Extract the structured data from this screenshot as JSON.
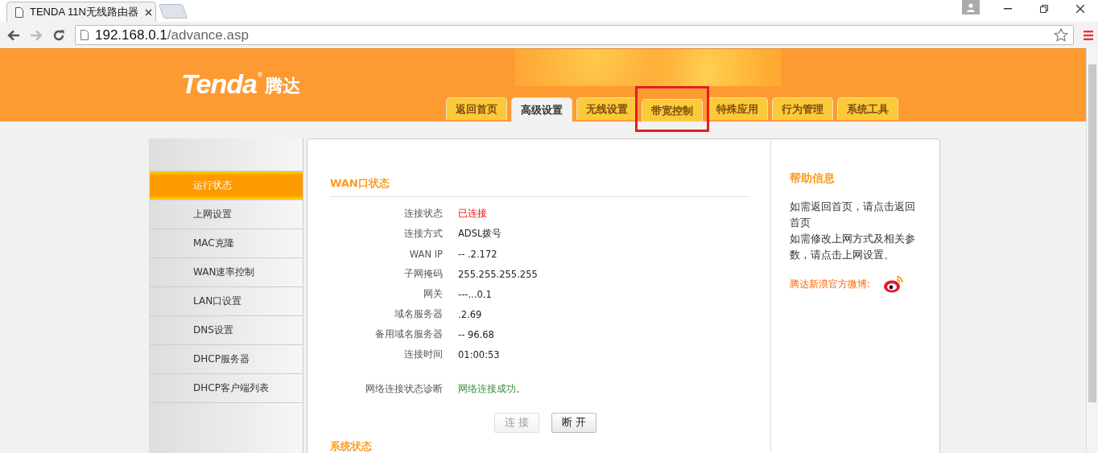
{
  "browser": {
    "tab_title": "TENDA 11N无线路由器",
    "address_host": "192.168.0.1",
    "address_path": "/advance.asp"
  },
  "header": {
    "logo": "Tenda",
    "logo_mark": "®",
    "logo_cn": "腾达",
    "tabs": [
      {
        "label": "返回首页",
        "selected": false,
        "highlighted": false
      },
      {
        "label": "高级设置",
        "selected": true,
        "highlighted": false
      },
      {
        "label": "无线设置",
        "selected": false,
        "highlighted": false
      },
      {
        "label": "带宽控制",
        "selected": false,
        "highlighted": true
      },
      {
        "label": "特殊应用",
        "selected": false,
        "highlighted": false
      },
      {
        "label": "行为管理",
        "selected": false,
        "highlighted": false
      },
      {
        "label": "系统工具",
        "selected": false,
        "highlighted": false
      }
    ]
  },
  "sidebar": {
    "items": [
      {
        "label": "运行状态",
        "selected": true
      },
      {
        "label": "上网设置",
        "selected": false
      },
      {
        "label": "MAC克隆",
        "selected": false
      },
      {
        "label": "WAN速率控制",
        "selected": false
      },
      {
        "label": "LAN口设置",
        "selected": false
      },
      {
        "label": "DNS设置",
        "selected": false
      },
      {
        "label": "DHCP服务器",
        "selected": false
      },
      {
        "label": "DHCP客户端列表",
        "selected": false
      }
    ]
  },
  "wan_status": {
    "title": "WAN口状态",
    "rows": [
      {
        "label": "连接状态",
        "value": "已连接",
        "kind": "alert"
      },
      {
        "label": "连接方式",
        "value": "ADSL拨号",
        "kind": "plain"
      },
      {
        "label": "WAN IP",
        "value": "-- .2.172",
        "kind": "plain"
      },
      {
        "label": "子网掩码",
        "value": "255.255.255.255",
        "kind": "plain"
      },
      {
        "label": "网关",
        "value": "---...0.1",
        "kind": "plain"
      },
      {
        "label": "域名服务器",
        "value": ".2.69",
        "kind": "plain"
      },
      {
        "label": "备用域名服务器",
        "value": "--  96.68",
        "kind": "plain"
      },
      {
        "label": "连接时间",
        "value": "01:00:53",
        "kind": "plain"
      }
    ],
    "diagnosis": {
      "label": "网络连接状态诊断",
      "value": "网络连接成功。"
    },
    "buttons": [
      {
        "label": "连 接",
        "disabled": true
      },
      {
        "label": "断 开",
        "disabled": false
      }
    ]
  },
  "system_status": {
    "title": "系统状态"
  },
  "help": {
    "title": "帮助信息",
    "paragraphs": [
      "如需返回首页，请点击返回首页",
      "如需修改上网方式及相关参数，请点击上网设置。"
    ],
    "weibo_label": "腾达新浪官方微博:"
  }
}
